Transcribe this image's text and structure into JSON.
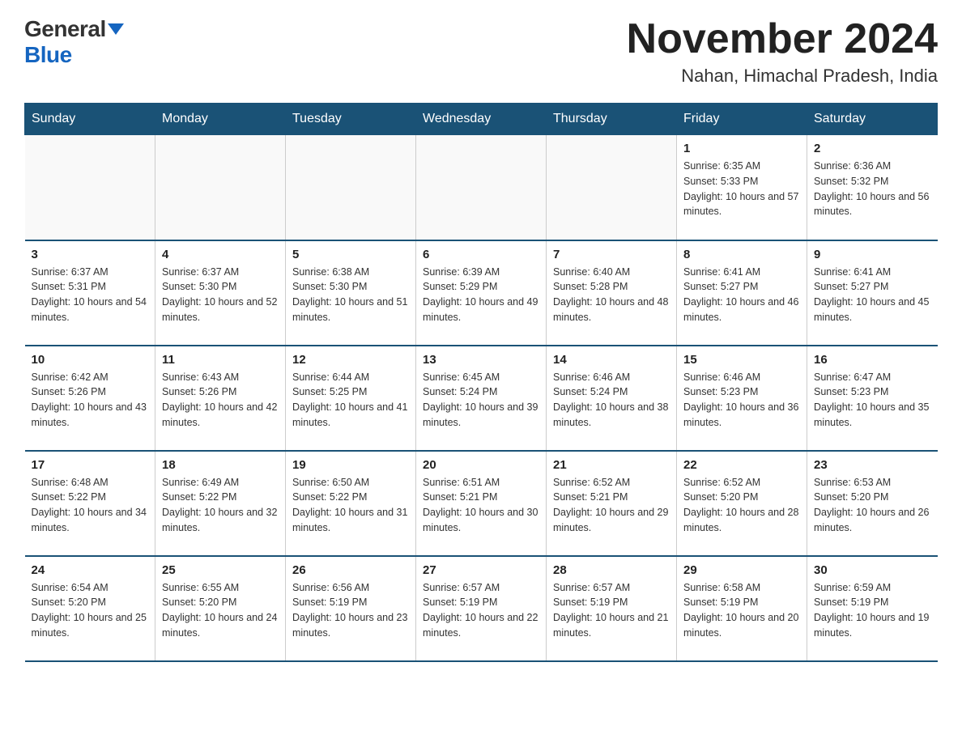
{
  "header": {
    "logo_general": "General",
    "logo_blue": "Blue",
    "month_title": "November 2024",
    "location": "Nahan, Himachal Pradesh, India"
  },
  "days_of_week": [
    "Sunday",
    "Monday",
    "Tuesday",
    "Wednesday",
    "Thursday",
    "Friday",
    "Saturday"
  ],
  "weeks": [
    [
      {
        "day": "",
        "info": ""
      },
      {
        "day": "",
        "info": ""
      },
      {
        "day": "",
        "info": ""
      },
      {
        "day": "",
        "info": ""
      },
      {
        "day": "",
        "info": ""
      },
      {
        "day": "1",
        "info": "Sunrise: 6:35 AM\nSunset: 5:33 PM\nDaylight: 10 hours and 57 minutes."
      },
      {
        "day": "2",
        "info": "Sunrise: 6:36 AM\nSunset: 5:32 PM\nDaylight: 10 hours and 56 minutes."
      }
    ],
    [
      {
        "day": "3",
        "info": "Sunrise: 6:37 AM\nSunset: 5:31 PM\nDaylight: 10 hours and 54 minutes."
      },
      {
        "day": "4",
        "info": "Sunrise: 6:37 AM\nSunset: 5:30 PM\nDaylight: 10 hours and 52 minutes."
      },
      {
        "day": "5",
        "info": "Sunrise: 6:38 AM\nSunset: 5:30 PM\nDaylight: 10 hours and 51 minutes."
      },
      {
        "day": "6",
        "info": "Sunrise: 6:39 AM\nSunset: 5:29 PM\nDaylight: 10 hours and 49 minutes."
      },
      {
        "day": "7",
        "info": "Sunrise: 6:40 AM\nSunset: 5:28 PM\nDaylight: 10 hours and 48 minutes."
      },
      {
        "day": "8",
        "info": "Sunrise: 6:41 AM\nSunset: 5:27 PM\nDaylight: 10 hours and 46 minutes."
      },
      {
        "day": "9",
        "info": "Sunrise: 6:41 AM\nSunset: 5:27 PM\nDaylight: 10 hours and 45 minutes."
      }
    ],
    [
      {
        "day": "10",
        "info": "Sunrise: 6:42 AM\nSunset: 5:26 PM\nDaylight: 10 hours and 43 minutes."
      },
      {
        "day": "11",
        "info": "Sunrise: 6:43 AM\nSunset: 5:26 PM\nDaylight: 10 hours and 42 minutes."
      },
      {
        "day": "12",
        "info": "Sunrise: 6:44 AM\nSunset: 5:25 PM\nDaylight: 10 hours and 41 minutes."
      },
      {
        "day": "13",
        "info": "Sunrise: 6:45 AM\nSunset: 5:24 PM\nDaylight: 10 hours and 39 minutes."
      },
      {
        "day": "14",
        "info": "Sunrise: 6:46 AM\nSunset: 5:24 PM\nDaylight: 10 hours and 38 minutes."
      },
      {
        "day": "15",
        "info": "Sunrise: 6:46 AM\nSunset: 5:23 PM\nDaylight: 10 hours and 36 minutes."
      },
      {
        "day": "16",
        "info": "Sunrise: 6:47 AM\nSunset: 5:23 PM\nDaylight: 10 hours and 35 minutes."
      }
    ],
    [
      {
        "day": "17",
        "info": "Sunrise: 6:48 AM\nSunset: 5:22 PM\nDaylight: 10 hours and 34 minutes."
      },
      {
        "day": "18",
        "info": "Sunrise: 6:49 AM\nSunset: 5:22 PM\nDaylight: 10 hours and 32 minutes."
      },
      {
        "day": "19",
        "info": "Sunrise: 6:50 AM\nSunset: 5:22 PM\nDaylight: 10 hours and 31 minutes."
      },
      {
        "day": "20",
        "info": "Sunrise: 6:51 AM\nSunset: 5:21 PM\nDaylight: 10 hours and 30 minutes."
      },
      {
        "day": "21",
        "info": "Sunrise: 6:52 AM\nSunset: 5:21 PM\nDaylight: 10 hours and 29 minutes."
      },
      {
        "day": "22",
        "info": "Sunrise: 6:52 AM\nSunset: 5:20 PM\nDaylight: 10 hours and 28 minutes."
      },
      {
        "day": "23",
        "info": "Sunrise: 6:53 AM\nSunset: 5:20 PM\nDaylight: 10 hours and 26 minutes."
      }
    ],
    [
      {
        "day": "24",
        "info": "Sunrise: 6:54 AM\nSunset: 5:20 PM\nDaylight: 10 hours and 25 minutes."
      },
      {
        "day": "25",
        "info": "Sunrise: 6:55 AM\nSunset: 5:20 PM\nDaylight: 10 hours and 24 minutes."
      },
      {
        "day": "26",
        "info": "Sunrise: 6:56 AM\nSunset: 5:19 PM\nDaylight: 10 hours and 23 minutes."
      },
      {
        "day": "27",
        "info": "Sunrise: 6:57 AM\nSunset: 5:19 PM\nDaylight: 10 hours and 22 minutes."
      },
      {
        "day": "28",
        "info": "Sunrise: 6:57 AM\nSunset: 5:19 PM\nDaylight: 10 hours and 21 minutes."
      },
      {
        "day": "29",
        "info": "Sunrise: 6:58 AM\nSunset: 5:19 PM\nDaylight: 10 hours and 20 minutes."
      },
      {
        "day": "30",
        "info": "Sunrise: 6:59 AM\nSunset: 5:19 PM\nDaylight: 10 hours and 19 minutes."
      }
    ]
  ]
}
